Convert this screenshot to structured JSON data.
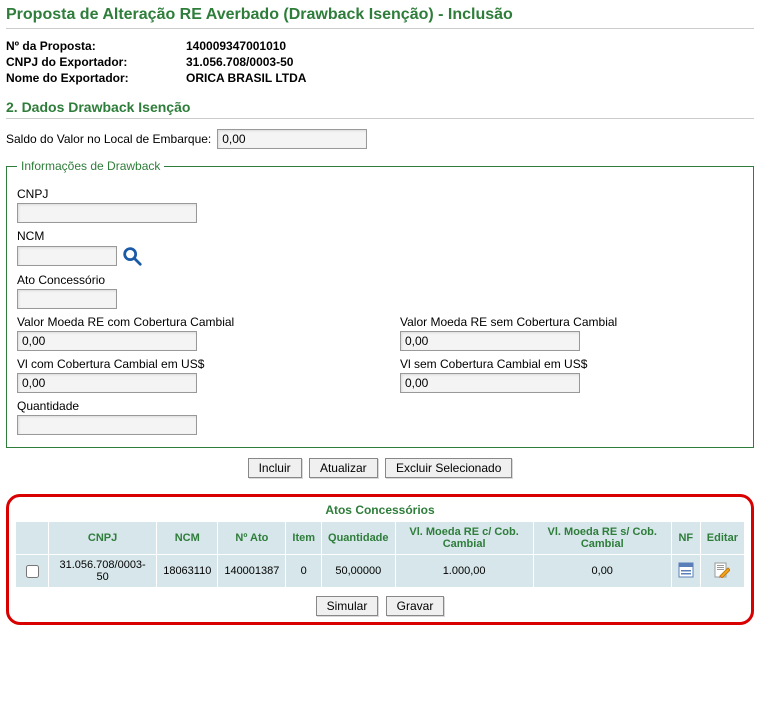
{
  "title": "Proposta de Alteração RE Averbado (Drawback Isenção) - Inclusão",
  "info": {
    "proposta_label": "Nº da Proposta:",
    "proposta_value": "140009347001010",
    "cnpj_exp_label": "CNPJ do Exportador:",
    "cnpj_exp_value": "31.056.708/0003-50",
    "nome_exp_label": "Nome do Exportador:",
    "nome_exp_value": "ORICA BRASIL LTDA"
  },
  "section2_title": "2. Dados Drawback Isenção",
  "saldo": {
    "label": "Saldo do Valor no Local de Embarque:",
    "value": "0,00"
  },
  "drawback": {
    "legend": "Informações de Drawback",
    "cnpj_label": "CNPJ",
    "cnpj_value": "",
    "ncm_label": "NCM",
    "ncm_value": "",
    "ato_label": "Ato Concessório",
    "ato_value": "",
    "val_re_com_label": "Valor Moeda RE com Cobertura Cambial",
    "val_re_com_value": "0,00",
    "val_re_sem_label": "Valor Moeda RE sem Cobertura Cambial",
    "val_re_sem_value": "0,00",
    "vl_com_label": "Vl com Cobertura Cambial em US$",
    "vl_com_value": "0,00",
    "vl_sem_label": "Vl sem Cobertura Cambial em US$",
    "vl_sem_value": "0,00",
    "qtd_label": "Quantidade",
    "qtd_value": ""
  },
  "buttons": {
    "incluir": "Incluir",
    "atualizar": "Atualizar",
    "excluir": "Excluir Selecionado",
    "simular": "Simular",
    "gravar": "Gravar"
  },
  "table": {
    "title": "Atos Concessórios",
    "headers": {
      "cnpj": "CNPJ",
      "ncm": "NCM",
      "ato": "Nº Ato",
      "item": "Item",
      "qtd": "Quantidade",
      "vl_com": "Vl. Moeda RE c/ Cob. Cambial",
      "vl_sem": "Vl. Moeda RE s/ Cob. Cambial",
      "nf": "NF",
      "editar": "Editar"
    },
    "row": {
      "cnpj": "31.056.708/0003-50",
      "ncm": "18063110",
      "ato": "140001387",
      "item": "0",
      "qtd": "50,00000",
      "vl_com": "1.000,00",
      "vl_sem": "0,00"
    }
  }
}
